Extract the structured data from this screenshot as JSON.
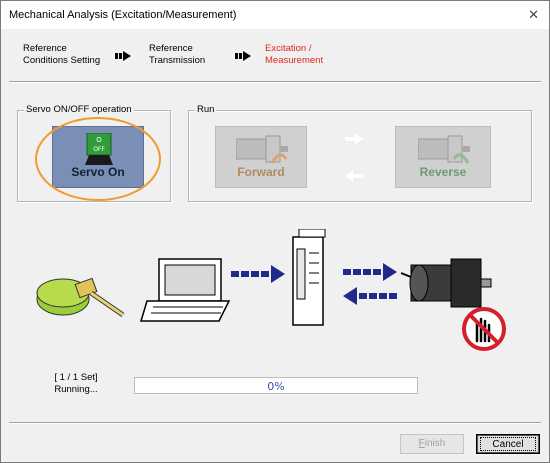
{
  "window": {
    "title": "Mechanical Analysis (Excitation/Measurement)",
    "close_glyph": "✕"
  },
  "steps": [
    {
      "line1": "Reference",
      "line2": "Conditions Setting",
      "state": "done"
    },
    {
      "line1": "Reference",
      "line2": "Transmission",
      "state": "done"
    },
    {
      "line1": "Excitation /",
      "line2": "Measurement",
      "state": "current",
      "color": "#e0261d"
    }
  ],
  "servo_group": {
    "label": "Servo ON/OFF operation",
    "button_label": "Servo On",
    "switch_top": "O",
    "switch_bottom": "OFF"
  },
  "run_group": {
    "label": "Run",
    "forward_label": "Forward",
    "reverse_label": "Reverse"
  },
  "progress": {
    "set_text": "[ 1 / 1 Set]",
    "status": "Running...",
    "percent_text": "0%",
    "value": 0
  },
  "buttons": {
    "finish": "Finish",
    "finish_mnemonic": "F",
    "cancel": "Cancel"
  },
  "colors": {
    "accent_orange": "#f29a2e",
    "arrow_navy": "#1f2a8a",
    "no_sign_red": "#d5202a",
    "servo_blue": "#7b8fb6"
  }
}
